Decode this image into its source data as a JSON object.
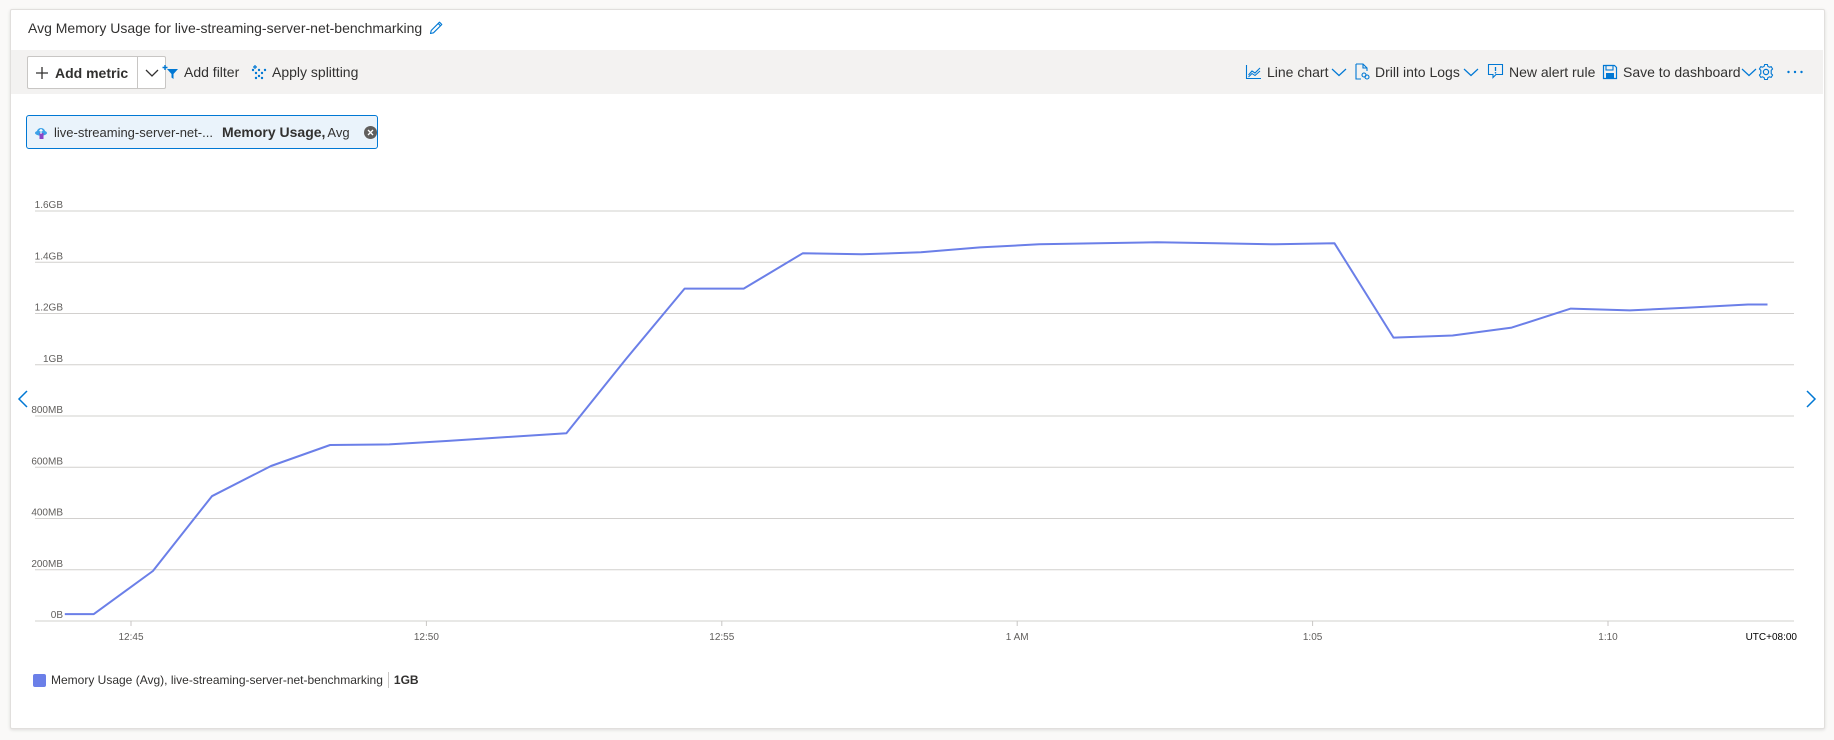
{
  "title": "Avg Memory Usage for live-streaming-server-net-benchmarking",
  "toolbar": {
    "add_metric": "Add metric",
    "add_filter": "Add filter",
    "apply_splitting": "Apply splitting",
    "line_chart": "Line chart",
    "drill_into_logs": "Drill into Logs",
    "new_alert_rule": "New alert rule",
    "save_to_dashboard": "Save to dashboard",
    "icons": [
      "plus-icon",
      "chevron-down-icon",
      "add-filter-icon",
      "apply-splitting-icon",
      "line-chart-icon",
      "drill-logs-icon",
      "alert-icon",
      "save-icon",
      "gear-icon",
      "more-icon"
    ]
  },
  "metric_pill": {
    "resource": "live-streaming-server-net-...",
    "metric": "Memory Usage,",
    "aggregation": "Avg"
  },
  "legend": {
    "label": "Memory Usage (Avg), live-streaming-server-net-benchmarking",
    "value": "1GB",
    "color": "#6b7fe8"
  },
  "chart_data": {
    "type": "line",
    "title": "Avg Memory Usage for live-streaming-server-net-benchmarking",
    "xlabel": "",
    "ylabel": "",
    "timezone_label": "UTC+08:00",
    "x_unit": "minutes since 12:45 (UTC+08:00)",
    "x_ticks": [
      {
        "label": "12:45",
        "t": 0
      },
      {
        "label": "12:50",
        "t": 5
      },
      {
        "label": "12:55",
        "t": 10
      },
      {
        "label": "1 AM",
        "t": 15
      },
      {
        "label": "1:05",
        "t": 20
      },
      {
        "label": "1:10",
        "t": 25
      }
    ],
    "y_unit": "GB",
    "y_ticks": [
      {
        "label": "0B",
        "v": 0
      },
      {
        "label": "200MB",
        "v": 0.2
      },
      {
        "label": "400MB",
        "v": 0.4
      },
      {
        "label": "600MB",
        "v": 0.6
      },
      {
        "label": "800MB",
        "v": 0.8
      },
      {
        "label": "1GB",
        "v": 1.0
      },
      {
        "label": "1.2GB",
        "v": 1.2
      },
      {
        "label": "1.4GB",
        "v": 1.4
      },
      {
        "label": "1.6GB",
        "v": 1.6
      }
    ],
    "xlim": [
      -1.12,
      27.85
    ],
    "ylim": [
      0,
      1.6
    ],
    "grid": true,
    "legend_position": "bottom-left",
    "series": [
      {
        "name": "Memory Usage (Avg), live-streaming-server-net-benchmarking",
        "color": "#6b7fe8",
        "x": [
          -1.12,
          -0.63,
          0.37,
          1.37,
          2.37,
          3.37,
          4.37,
          5.37,
          6.37,
          7.37,
          8.37,
          9.37,
          10.37,
          11.37,
          12.37,
          13.37,
          14.37,
          15.37,
          16.37,
          17.37,
          18.37,
          19.37,
          20.37,
          21.37,
          22.37,
          23.37,
          24.37,
          25.37,
          26.37,
          27.37,
          27.7
        ],
        "values": [
          0.027,
          0.027,
          0.195,
          0.487,
          0.605,
          0.687,
          0.689,
          0.703,
          0.718,
          0.733,
          1.02,
          1.297,
          1.297,
          1.435,
          1.431,
          1.439,
          1.458,
          1.47,
          1.474,
          1.478,
          1.474,
          1.47,
          1.474,
          1.106,
          1.114,
          1.145,
          1.219,
          1.212,
          1.223,
          1.235,
          1.235
        ]
      }
    ]
  }
}
